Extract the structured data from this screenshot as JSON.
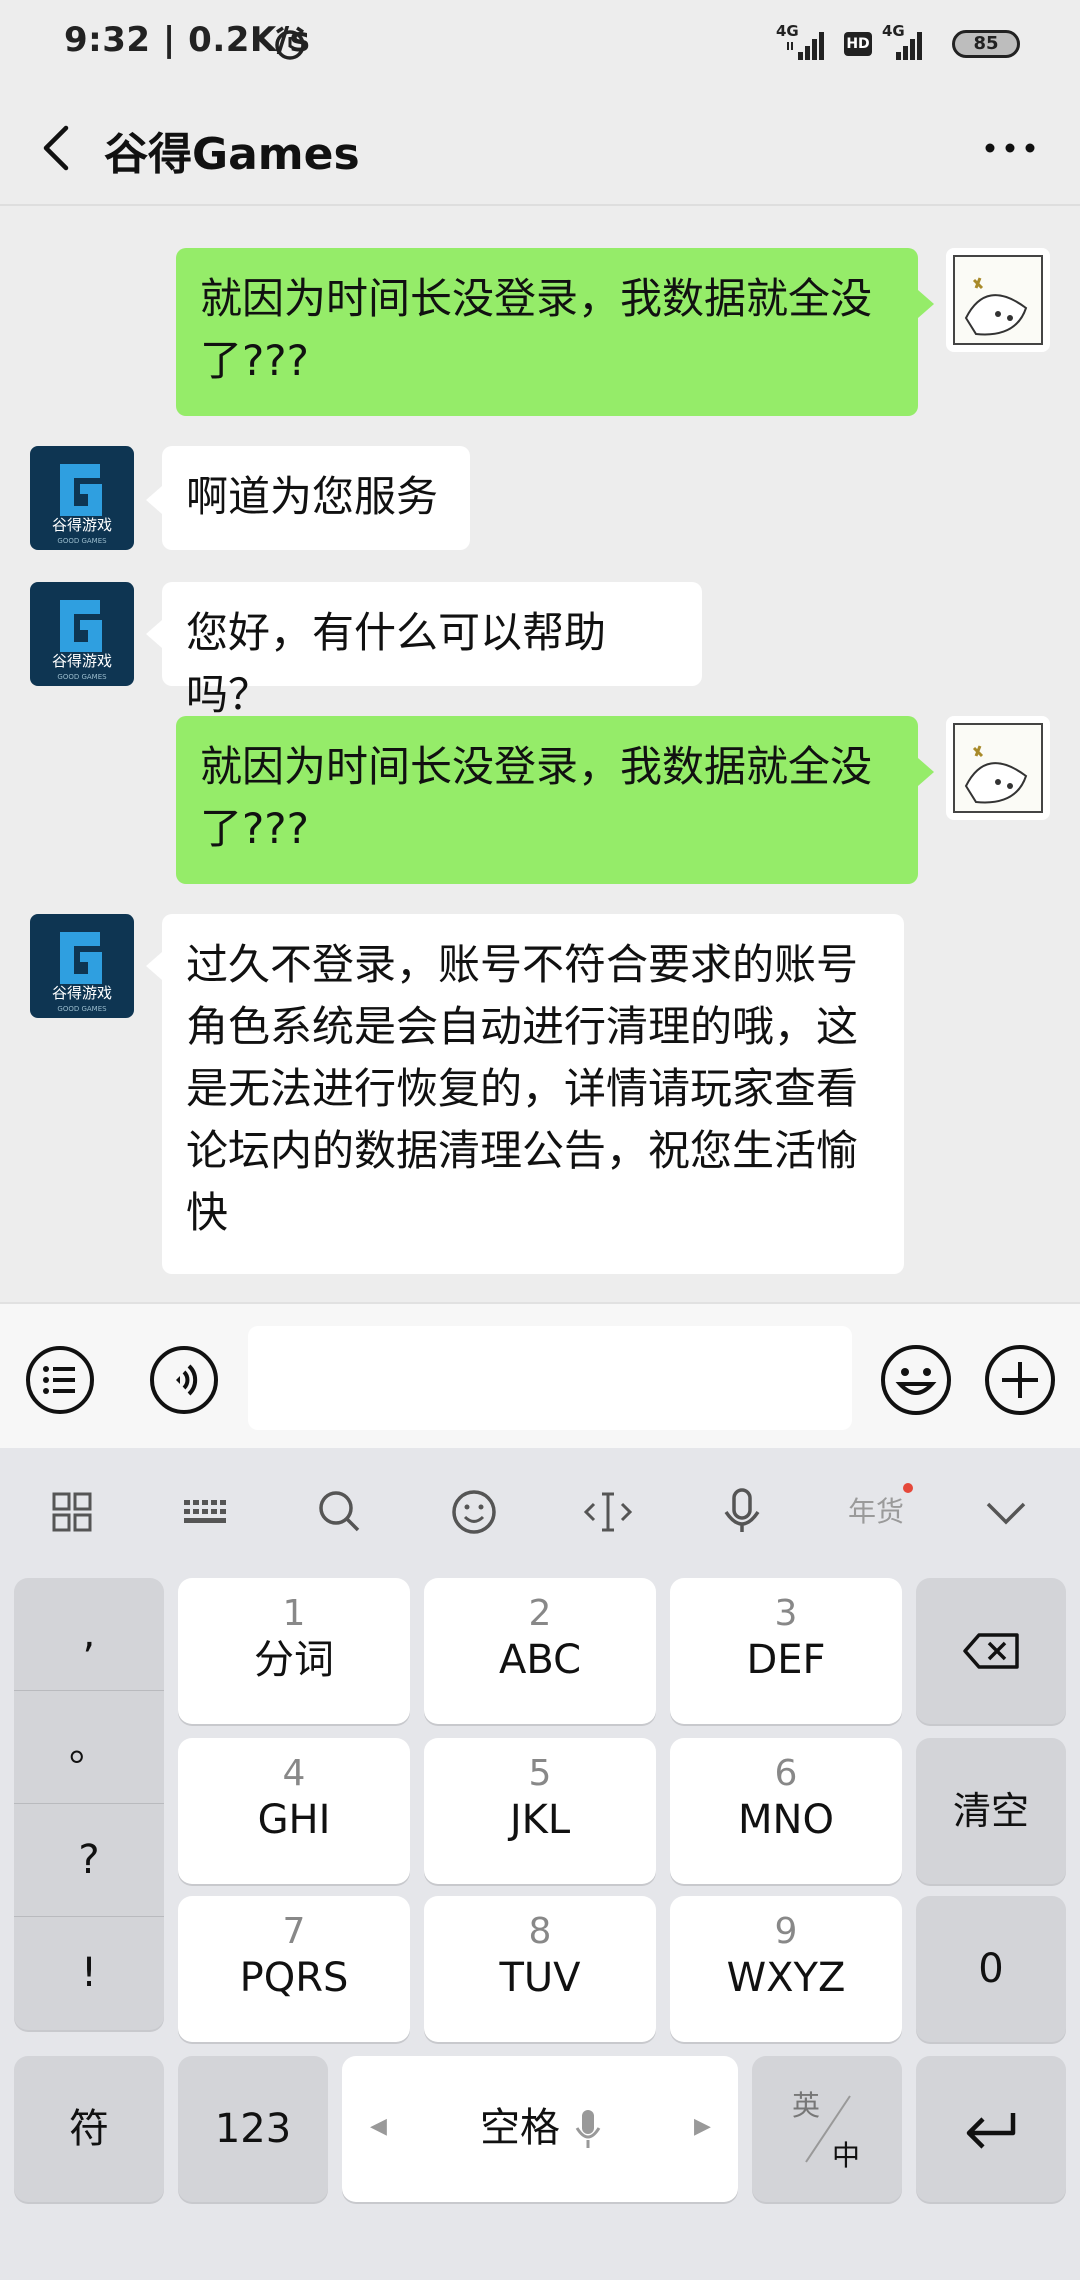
{
  "status_bar": {
    "time": "9:32 | 0.2K/s",
    "network1": "4G",
    "hd": "HD",
    "network2": "4G",
    "battery": "85"
  },
  "header": {
    "title": "谷得Games"
  },
  "messages": [
    {
      "from": "me",
      "text": "就因为时间长没登录，我数据就全没了???"
    },
    {
      "from": "them",
      "text": "啊道为您服务"
    },
    {
      "from": "them",
      "text": "您好，有什么可以帮助吗？"
    },
    {
      "from": "me",
      "text": "就因为时间长没登录，我数据就全没了???"
    },
    {
      "from": "them",
      "text": "过久不登录，账号不符合要求的账号角色系统是会自动进行清理的哦，这是无法进行恢复的，详情请玩家查看论坛内的数据清理公告，祝您生活愉快"
    }
  ],
  "avatar": {
    "logo_text": "谷得游戏",
    "logo_sub": "GOOD GAMES"
  },
  "input": {
    "value": ""
  },
  "keyboard": {
    "punct": [
      ",",
      "。",
      "?",
      "!"
    ],
    "keys": [
      {
        "num": "1",
        "letters": "分词"
      },
      {
        "num": "2",
        "letters": "ABC"
      },
      {
        "num": "3",
        "letters": "DEF"
      },
      {
        "num": "4",
        "letters": "GHI"
      },
      {
        "num": "5",
        "letters": "JKL"
      },
      {
        "num": "6",
        "letters": "MNO"
      },
      {
        "num": "7",
        "letters": "PQRS"
      },
      {
        "num": "8",
        "letters": "TUV"
      },
      {
        "num": "9",
        "letters": "WXYZ"
      }
    ],
    "clear": "清空",
    "zero": "0",
    "symbol": "符",
    "num123": "123",
    "space": "空格",
    "lang_top": "英",
    "lang_bottom": "中",
    "toolbar_badge": "年货"
  },
  "colors": {
    "my_bubble": "#95ec69",
    "their_bubble": "#ffffff",
    "background": "#ededed"
  }
}
